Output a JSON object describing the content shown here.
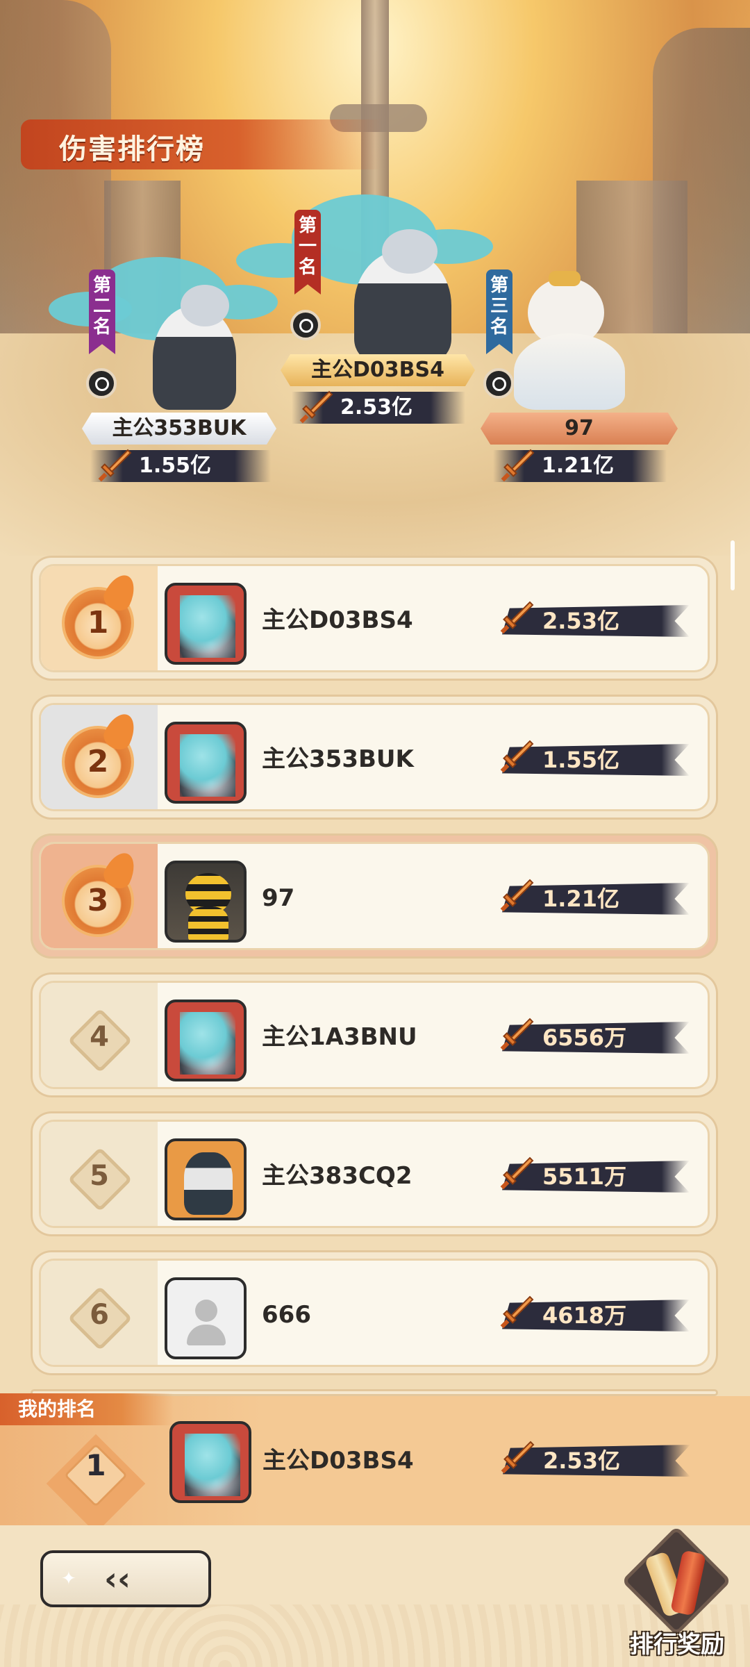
{
  "header": {
    "title": "伤害排行榜"
  },
  "podium": [
    {
      "place_label": "第二名",
      "name": "主公353BUK",
      "score": "1.55亿"
    },
    {
      "place_label": "第一名",
      "name": "主公D03BS4",
      "score": "2.53亿"
    },
    {
      "place_label": "第三名",
      "name": "97",
      "score": "1.21亿"
    }
  ],
  "ranking": [
    {
      "rank": "1",
      "name": "主公D03BS4",
      "score": "2.53亿",
      "avatar": "tentacle-hero"
    },
    {
      "rank": "2",
      "name": "主公353BUK",
      "score": "1.55亿",
      "avatar": "tentacle-hero"
    },
    {
      "rank": "3",
      "name": "97",
      "score": "1.21亿",
      "avatar": "bee-costume-cat"
    },
    {
      "rank": "4",
      "name": "主公1A3BNU",
      "score": "6556万",
      "avatar": "tentacle-hero"
    },
    {
      "rank": "5",
      "name": "主公383CQ2",
      "score": "5511万",
      "avatar": "masked-warrior"
    },
    {
      "rank": "6",
      "name": "666",
      "score": "4618万",
      "avatar": "default-user"
    }
  ],
  "my_rank": {
    "label": "我的排名",
    "rank": "1",
    "name": "主公D03BS4",
    "score": "2.53亿"
  },
  "footer": {
    "back_icon": "back-arrow-icon",
    "reward_label": "排行奖励"
  },
  "colors": {
    "accent": "#d8612c",
    "score_bar": "#2c2c3c",
    "panel": "#fbf7ec"
  }
}
